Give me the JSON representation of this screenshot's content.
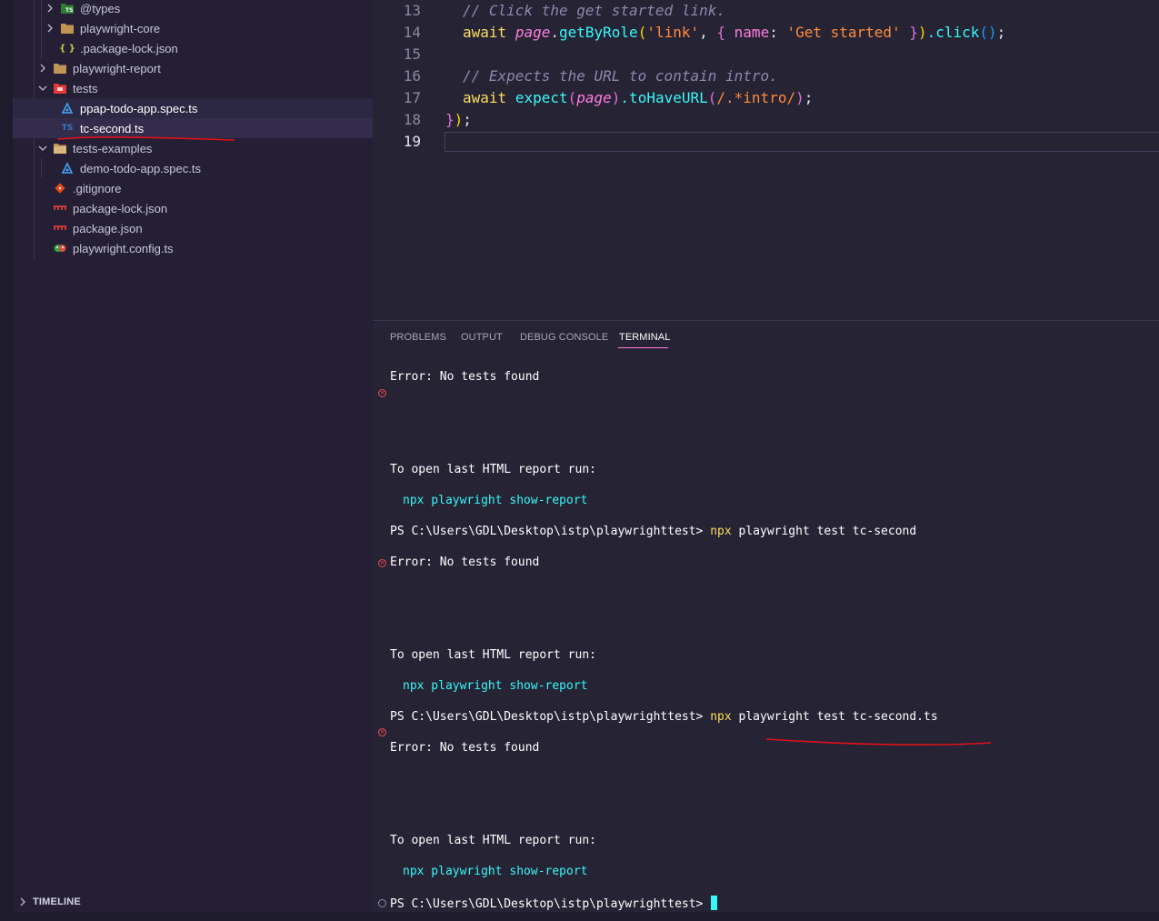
{
  "sidebar": {
    "items": [
      {
        "label": "@types",
        "icon": "ts-folder-icon",
        "expanded": false
      },
      {
        "label": "playwright-core",
        "icon": "folder-icon",
        "expanded": false
      },
      {
        "label": ".package-lock.json",
        "icon": "json-braces-icon"
      },
      {
        "label": "playwright-report",
        "icon": "folder-icon",
        "expanded": false
      },
      {
        "label": "tests",
        "icon": "tests-folder-icon",
        "expanded": true
      },
      {
        "label": "ppap-todo-app.spec.ts",
        "icon": "test-spec-icon"
      },
      {
        "label": "tc-second.ts",
        "icon": "typescript-file-icon"
      },
      {
        "label": "tests-examples",
        "icon": "folder-open-icon",
        "expanded": true
      },
      {
        "label": "demo-todo-app.spec.ts",
        "icon": "test-spec-icon"
      },
      {
        "label": ".gitignore",
        "icon": "git-icon"
      },
      {
        "label": "package-lock.json",
        "icon": "npm-icon"
      },
      {
        "label": "package.json",
        "icon": "npm-icon"
      },
      {
        "label": "playwright.config.ts",
        "icon": "playwright-icon"
      }
    ],
    "ts_badge": "TS",
    "json_braces": "{ }",
    "timeline_label": "TIMELINE"
  },
  "editor": {
    "line_numbers": [
      "13",
      "14",
      "15",
      "16",
      "17",
      "18",
      "19"
    ],
    "lines": {
      "l13_comment": "// Click the get started link.",
      "l14_await": "await",
      "l14_page": "page",
      "l14_dot1": ".",
      "l14_fn": "getByRole",
      "l14_paren_open": "(",
      "l14_str1": "'link'",
      "l14_comma": ", ",
      "l14_brace_open": "{",
      "l14_prop": " name",
      "l14_colon": ": ",
      "l14_str2": "'Get started'",
      "l14_brace_close": " }",
      "l14_paren_close": ")",
      "l14_click": ".click",
      "l14_call": "()",
      "l14_semi": ";",
      "l16_comment": "// Expects the URL to contain intro.",
      "l17_await": "await",
      "l17_expect": "expect",
      "l17_paren_open": "(",
      "l17_page": "page",
      "l17_paren_close": ")",
      "l17_fn": ".toHaveURL",
      "l17_paren2_open": "(",
      "l17_regex": "/.*intro/",
      "l17_paren2_close": ")",
      "l17_semi": ";",
      "l18_close_brace": "}",
      "l18_close_paren": ")",
      "l18_semi": ";"
    }
  },
  "panel": {
    "tabs": [
      "PROBLEMS",
      "OUTPUT",
      "DEBUG CONSOLE",
      "TERMINAL"
    ],
    "active_tab": "TERMINAL",
    "terminal": {
      "error_1": "Error: No tests found",
      "open_report_1": "To open last HTML report run:",
      "show_report_cmd_1": "npx playwright show-report",
      "prompt_1": "PS C:\\Users\\GDL\\Desktop\\istp\\playwrighttest> ",
      "cmd_1_npx": "npx",
      "cmd_1_rest": " playwright test tc-second",
      "error_2": "Error: No tests found",
      "open_report_2": "To open last HTML report run:",
      "show_report_cmd_2": "npx playwright show-report",
      "prompt_2": "PS C:\\Users\\GDL\\Desktop\\istp\\playwrighttest> ",
      "cmd_2_npx": "npx",
      "cmd_2_rest": " playwright test tc-second.ts",
      "error_3": "Error: No tests found",
      "open_report_3": "To open last HTML report run:",
      "show_report_cmd_3": "npx playwright show-report",
      "prompt_3": "PS C:\\Users\\GDL\\Desktop\\istp\\playwrighttest> "
    }
  },
  "colors": {
    "background": "#262335",
    "sidebar": "#241f35",
    "accent_pink": "#ff7edb",
    "accent_cyan": "#36f9f6",
    "keyword_yellow": "#fede5d",
    "string_orange": "#ff8b39",
    "error_red": "#f14c4c",
    "annotation_red": "#e0101a"
  }
}
